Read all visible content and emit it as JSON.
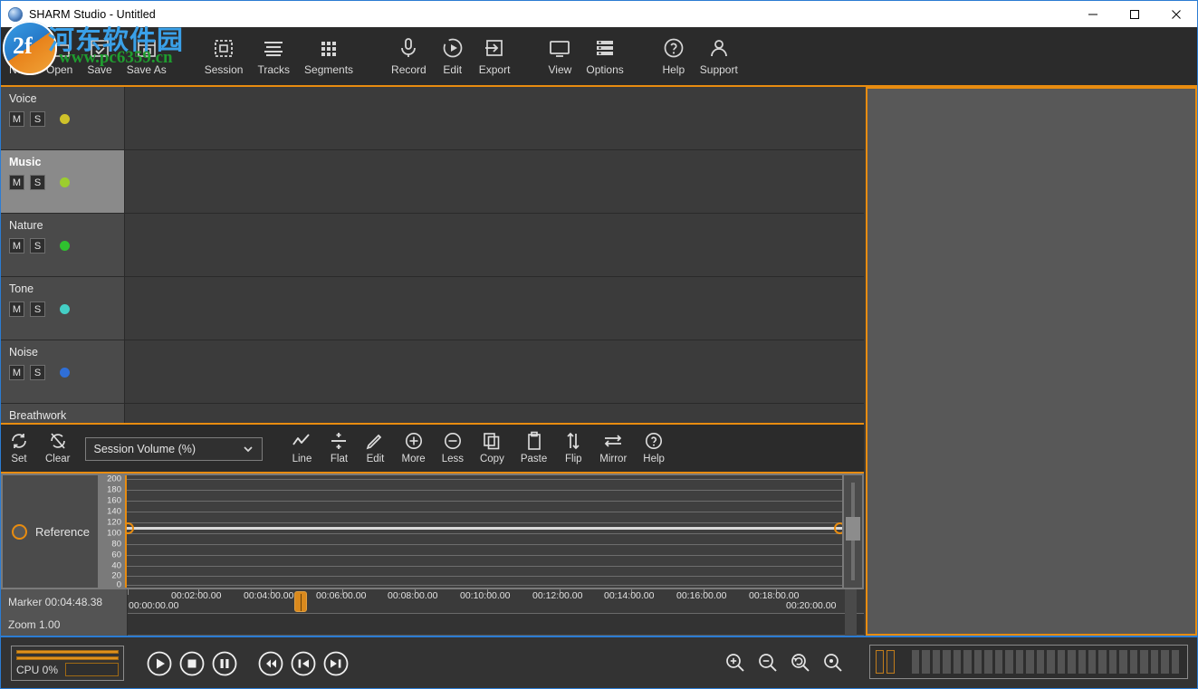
{
  "window": {
    "title": "SHARM Studio - Untitled",
    "icon": "app-globe-icon",
    "minimize_label": "Minimize",
    "maximize_label": "Maximize",
    "close_label": "Close",
    "accent_color": "#e88c10",
    "border_color": "#2b7cd3"
  },
  "watermark": {
    "badge_text": "2f",
    "chinese_text": "河东软件园",
    "url_text": "www.pc6359.cn"
  },
  "toolbar": {
    "groups": [
      {
        "items": [
          {
            "label": "New",
            "icon": "new-document-icon"
          },
          {
            "label": "Open",
            "icon": "open-folder-icon"
          },
          {
            "label": "Save",
            "icon": "save-check-icon"
          },
          {
            "label": "Save As",
            "icon": "save-as-icon"
          }
        ]
      },
      {
        "items": [
          {
            "label": "Session",
            "icon": "session-dashed-square-icon"
          },
          {
            "label": "Tracks",
            "icon": "tracks-lines-icon"
          },
          {
            "label": "Segments",
            "icon": "segments-grid-icon"
          }
        ]
      },
      {
        "items": [
          {
            "label": "Record",
            "icon": "microphone-icon"
          },
          {
            "label": "Edit",
            "icon": "edit-play-circle-icon"
          },
          {
            "label": "Export",
            "icon": "export-arrow-icon"
          }
        ]
      },
      {
        "items": [
          {
            "label": "View",
            "icon": "monitor-icon"
          },
          {
            "label": "Options",
            "icon": "options-list-icon"
          }
        ]
      },
      {
        "items": [
          {
            "label": "Help",
            "icon": "help-question-icon"
          },
          {
            "label": "Support",
            "icon": "support-person-icon"
          }
        ]
      }
    ]
  },
  "tracks": {
    "mute_label": "M",
    "solo_label": "S",
    "items": [
      {
        "name": "Voice",
        "color": "#cfc22a",
        "selected": false
      },
      {
        "name": "Music",
        "color": "#9ccd2e",
        "selected": true
      },
      {
        "name": "Nature",
        "color": "#2fc22f",
        "selected": false
      },
      {
        "name": "Tone",
        "color": "#44cfc6",
        "selected": false
      },
      {
        "name": "Noise",
        "color": "#2f6fd8",
        "selected": false
      },
      {
        "name": "Breathwork",
        "color": "#8a6fd8",
        "selected": false
      }
    ]
  },
  "envelope_toolbar": {
    "left_items": [
      {
        "label": "Set",
        "icon": "refresh-set-icon"
      },
      {
        "label": "Clear",
        "icon": "clear-crossed-icon"
      }
    ],
    "select": {
      "value": "Session Volume (%)",
      "icon": "chevron-down-icon"
    },
    "right_items": [
      {
        "label": "Line",
        "icon": "line-curve-icon"
      },
      {
        "label": "Flat",
        "icon": "flat-divide-icon"
      },
      {
        "label": "Edit",
        "icon": "pencil-icon"
      },
      {
        "label": "More",
        "icon": "plus-circle-icon"
      },
      {
        "label": "Less",
        "icon": "minus-circle-icon"
      },
      {
        "label": "Copy",
        "icon": "copy-icon"
      },
      {
        "label": "Paste",
        "icon": "clipboard-paste-icon"
      },
      {
        "label": "Flip",
        "icon": "flip-vertical-arrows-icon"
      },
      {
        "label": "Mirror",
        "icon": "mirror-horizontal-arrows-icon"
      },
      {
        "label": "Help",
        "icon": "help-question-icon"
      }
    ]
  },
  "envelope": {
    "reference_label": "Reference",
    "reference_dot_color": "#e88c10",
    "scale_ticks": [
      "200",
      "180",
      "160",
      "140",
      "120",
      "100",
      "80",
      "60",
      "40",
      "20",
      "0"
    ],
    "scale_max": 200,
    "scale_min": 0,
    "current_value": 110,
    "line_color": "#d8d8d8"
  },
  "timeline": {
    "marker_label": "Marker 00:04:48.38",
    "zoom_label": "Zoom 1.00",
    "start_time": "00:00:00.00",
    "end_time": "00:20:00.00",
    "ticks": [
      "00:02:00.00",
      "00:04:00.00",
      "00:06:00.00",
      "00:08:00.00",
      "00:10:00.00",
      "00:12:00.00",
      "00:14:00.00",
      "00:16:00.00",
      "00:18:00.00"
    ],
    "playhead_time": "00:04:48.38"
  },
  "transport": {
    "cpu_label": "CPU 0%",
    "cpu_percent": 0,
    "buttons": [
      {
        "name": "play-button",
        "icon": "play-icon"
      },
      {
        "name": "stop-button",
        "icon": "stop-icon"
      },
      {
        "name": "pause-button",
        "icon": "pause-icon"
      },
      {
        "name": "rewind-button",
        "icon": "rewind-icon"
      },
      {
        "name": "skip-start-button",
        "icon": "skip-to-start-icon"
      },
      {
        "name": "skip-end-button",
        "icon": "skip-to-end-icon"
      }
    ],
    "zoom_buttons": [
      {
        "name": "zoom-in-button",
        "icon": "magnifier-plus-icon"
      },
      {
        "name": "zoom-out-button",
        "icon": "magnifier-minus-icon"
      },
      {
        "name": "zoom-reset-button",
        "icon": "magnifier-undo-icon"
      },
      {
        "name": "zoom-fit-button",
        "icon": "magnifier-dot-icon"
      }
    ],
    "vu_meter_segments": 26
  }
}
